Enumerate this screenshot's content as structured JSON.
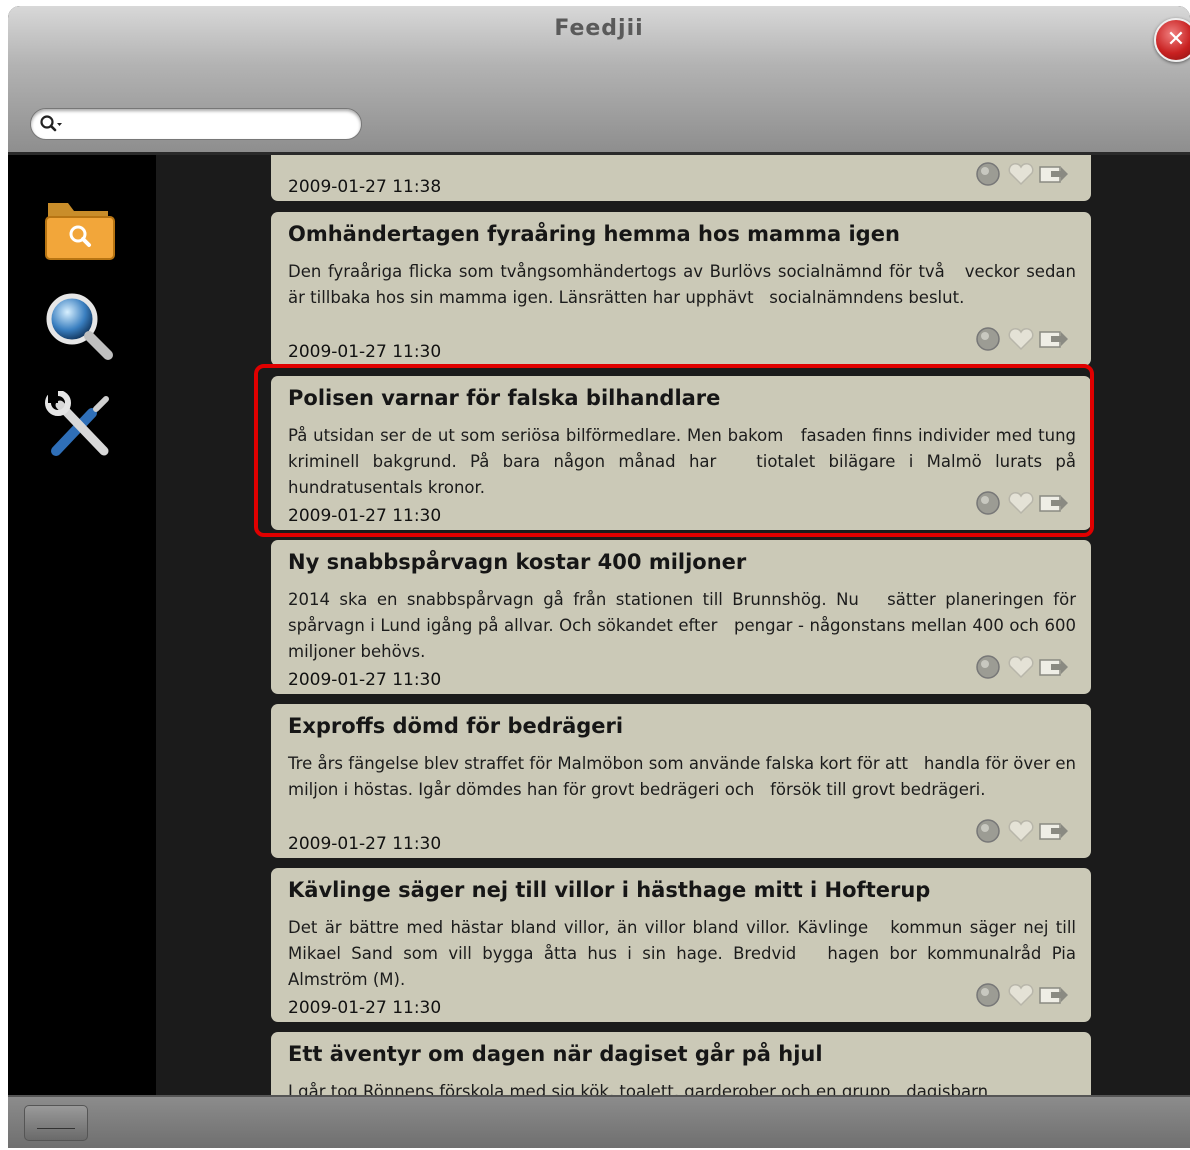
{
  "window": {
    "title": "Feedjii",
    "close_glyph": "✕"
  },
  "search": {
    "value": "",
    "placeholder": ""
  },
  "sidebar": {
    "items": [
      {
        "icon": "folder-search-icon"
      },
      {
        "icon": "magnifier-icon"
      },
      {
        "icon": "tools-icon"
      }
    ]
  },
  "feed": {
    "items": [
      {
        "title": "",
        "desc": "",
        "date": "2009-01-27 11:38"
      },
      {
        "title": "Omhändertagen fyraåring hemma hos mamma igen",
        "desc": "Den fyraåriga flicka som tvångsomhändertogs av Burlövs socialnämnd för två   veckor sedan är tillbaka hos sin mamma igen. Länsrätten har upphävt   socialnämndens beslut.",
        "date": "2009-01-27 11:30"
      },
      {
        "title": "Polisen varnar för falska bilhandlare",
        "desc": "På utsidan ser de ut som seriösa bilförmedlare. Men bakom   fasaden finns individer med tung kriminell bakgrund. På bara någon månad har   tiotalet bilägare i Malmö lurats på hundratusentals kronor.",
        "date": "2009-01-27 11:30"
      },
      {
        "title": "Ny snabbspårvagn kostar 400 miljoner",
        "desc": "2014 ska en snabbspårvagn gå från stationen till Brunnshög. Nu   sätter planeringen för spårvagn i Lund igång på allvar. Och sökandet efter   pengar - någonstans mellan 400 och 600 miljoner behövs.",
        "date": "2009-01-27 11:30"
      },
      {
        "title": "Exproffs dömd för bedrägeri",
        "desc": "Tre års fängelse blev straffet för Malmöbon som använde falska kort för att   handla för över en miljon i höstas. Igår dömdes han för grovt bedrägeri och   försök till grovt bedrägeri.",
        "date": "2009-01-27 11:30"
      },
      {
        "title": "Kävlinge säger nej till villor i hästhage mitt i Hofterup",
        "desc": "Det är bättre med hästar bland villor, än villor bland villor. Kävlinge   kommun säger nej till Mikael Sand som vill bygga åtta hus i sin hage. Bredvid   hagen bor kommunalråd Pia Almström (M).",
        "date": "2009-01-27 11:30"
      },
      {
        "title": "Ett äventyr om dagen när dagiset går på hjul",
        "desc": "I går tog Rönnens förskola med sig kök, toalett, garderober och en grupp   dagisbarn",
        "date": ""
      }
    ],
    "selected_index": 2
  },
  "colors": {
    "card_bg": "#cbc9b7",
    "selection": "#e00000",
    "background": "#1b1b1b"
  }
}
